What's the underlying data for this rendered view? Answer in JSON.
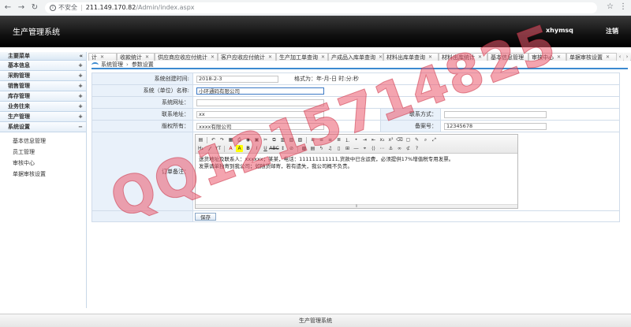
{
  "browser": {
    "insecure_label": "不安全",
    "url_host": "211.149.170.82",
    "url_path": "/Admin/index.aspx"
  },
  "header": {
    "title": "生产管理系统",
    "user": "xhymsq",
    "logout": "注销"
  },
  "sidebar": {
    "heading": "主要菜单",
    "collapse_symbol": "«",
    "groups": [
      {
        "label": "基本信息",
        "symbol": "+"
      },
      {
        "label": "采购管理",
        "symbol": "+"
      },
      {
        "label": "销售管理",
        "symbol": "+"
      },
      {
        "label": "库存管理",
        "symbol": "+"
      },
      {
        "label": "业务往来",
        "symbol": "+"
      },
      {
        "label": "生产管理",
        "symbol": "+"
      },
      {
        "label": "系统设置",
        "symbol": "−"
      }
    ],
    "sub_items": [
      "基本信息管理",
      "员工管理",
      "审核中心",
      "单据审核设置"
    ]
  },
  "tabs": [
    "计",
    "收款统计",
    "供应商应收应付统计",
    "客户应收应付统计",
    "生产加工单查询",
    "产成品入库单查询",
    "材料出库单查询",
    "材料出库统计",
    "基本信息管理",
    "审核中心",
    "单据审核设置"
  ],
  "breadcrumb": {
    "root": "系统管理",
    "current": "参数设置"
  },
  "form": {
    "created_label": "系统创建时间:",
    "created_value": "2018-2-3",
    "created_hint": "格式为：年-月-日 时:分:秒",
    "company_label": "系统（单位）名称:",
    "company_value": "小环通码有限公司",
    "url_label": "系统网址：",
    "url_value": "",
    "address_label": "联系地址：",
    "address_value": "xx",
    "contact_label": "联系方式：",
    "contact_value": "",
    "copyright_label": "版权所有：",
    "copyright_value": "xxxx有限公司",
    "record_label": "备案号：",
    "record_value": "12345678",
    "remark_label": "订单备注：",
    "remark_line1": "送货地址及联系人：xxxxxx；某某，电话：111111111111,货款中已含运费，必须提供17%增值税专用发票。",
    "remark_line2": "发票请单独寄到我公司；如随货邮寄，若有遗失，我公司概不负责。",
    "save_label": "保存"
  },
  "footer": {
    "text": "生产管理系统"
  },
  "watermark": {
    "text": "QQ1215714825"
  }
}
